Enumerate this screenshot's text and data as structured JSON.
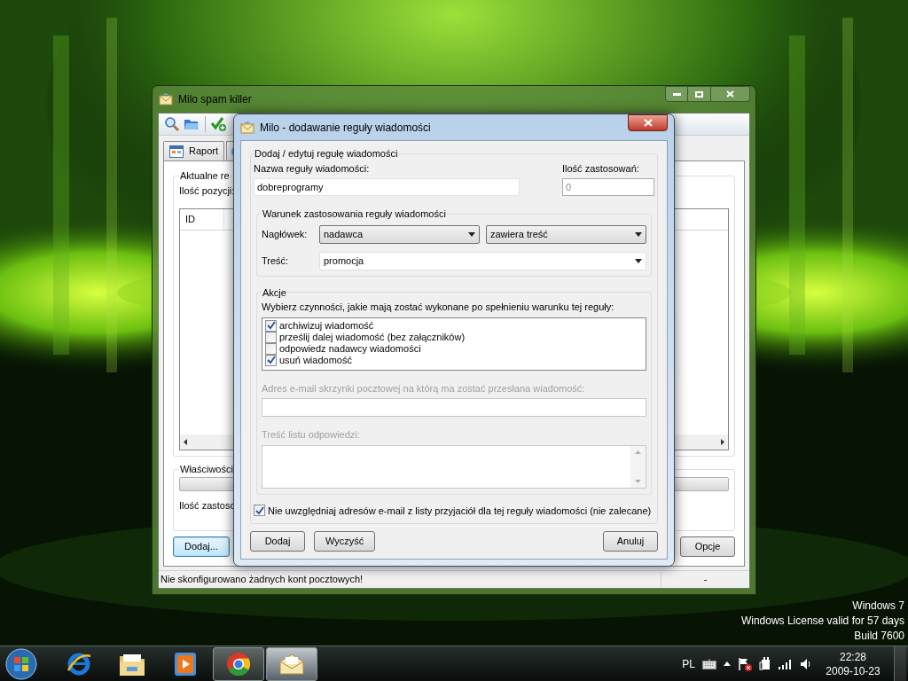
{
  "desktop": {
    "notice": [
      "Windows 7",
      "Windows License valid for 57 days",
      "Build 7600"
    ]
  },
  "main_window": {
    "title": "Milo spam killer",
    "tabs": [
      {
        "label": "Raport",
        "selected": false
      }
    ],
    "rules_group": {
      "title": "Aktualne re",
      "count_label": "Ilość pozycji:",
      "columns": [
        "ID"
      ]
    },
    "properties_group": {
      "title": "Właściwości",
      "count_label": "Ilość zastoso"
    },
    "buttons": [
      {
        "label": "Dodaj...",
        "focused": true
      },
      {
        "label": "Opcje",
        "focused": false
      }
    ],
    "status_bar": [
      "Nie skonfigurowano żadnych kont pocztowych!",
      "-"
    ]
  },
  "dialog": {
    "title": "Milo - dodawanie reguły wiadomości",
    "group_title": "Dodaj / edytuj regułę wiadomości",
    "name_label": "Nazwa reguły wiadomości:",
    "name_value": "dobreprogramy",
    "count_label": "Ilość zastosowań:",
    "count_value": "0",
    "condition": {
      "title": "Warunek zastosowania reguły wiadomości",
      "header_label": "Nagłówek:",
      "header_value": "nadawca",
      "operator_value": "zawiera treść",
      "content_label": "Treść:",
      "content_value": "promocja"
    },
    "actions": {
      "title": "Akcje",
      "instruction": "Wybierz czynności, jakie mają zostać wykonane po spełnieniu warunku tej reguły:",
      "items": [
        {
          "label": "archiwizuj wiadomość",
          "checked": true
        },
        {
          "label": "prześlij dalej wiadomość (bez załączników)",
          "checked": false
        },
        {
          "label": "odpowiedz nadawcy wiadomości",
          "checked": false
        },
        {
          "label": "usuń wiadomość",
          "checked": true
        }
      ],
      "forward_label": "Adres e-mail skrzynki pocztowej na którą ma zostać przesłana wiadomość:",
      "forward_disabled": true,
      "reply_label": "Treść listu odpowiedzi:",
      "reply_disabled": true
    },
    "exclude_friends": {
      "label": "Nie uwzględniaj adresów e-mail z listy przyjaciół dla tej reguły wiadomości (nie zalecane)",
      "checked": true
    },
    "buttons": [
      "Dodaj",
      "Wyczyść",
      "Anuluj"
    ]
  },
  "taskbar": {
    "apps": [
      {
        "kind": "ie",
        "running": false,
        "selected": false
      },
      {
        "kind": "explorer",
        "running": false,
        "selected": false
      },
      {
        "kind": "media",
        "running": false,
        "selected": false
      },
      {
        "kind": "chrome",
        "running": true,
        "selected": false
      },
      {
        "kind": "mail",
        "running": true,
        "selected": true
      }
    ],
    "language": "PL",
    "time": "22:28",
    "date": "2009-10-23"
  }
}
